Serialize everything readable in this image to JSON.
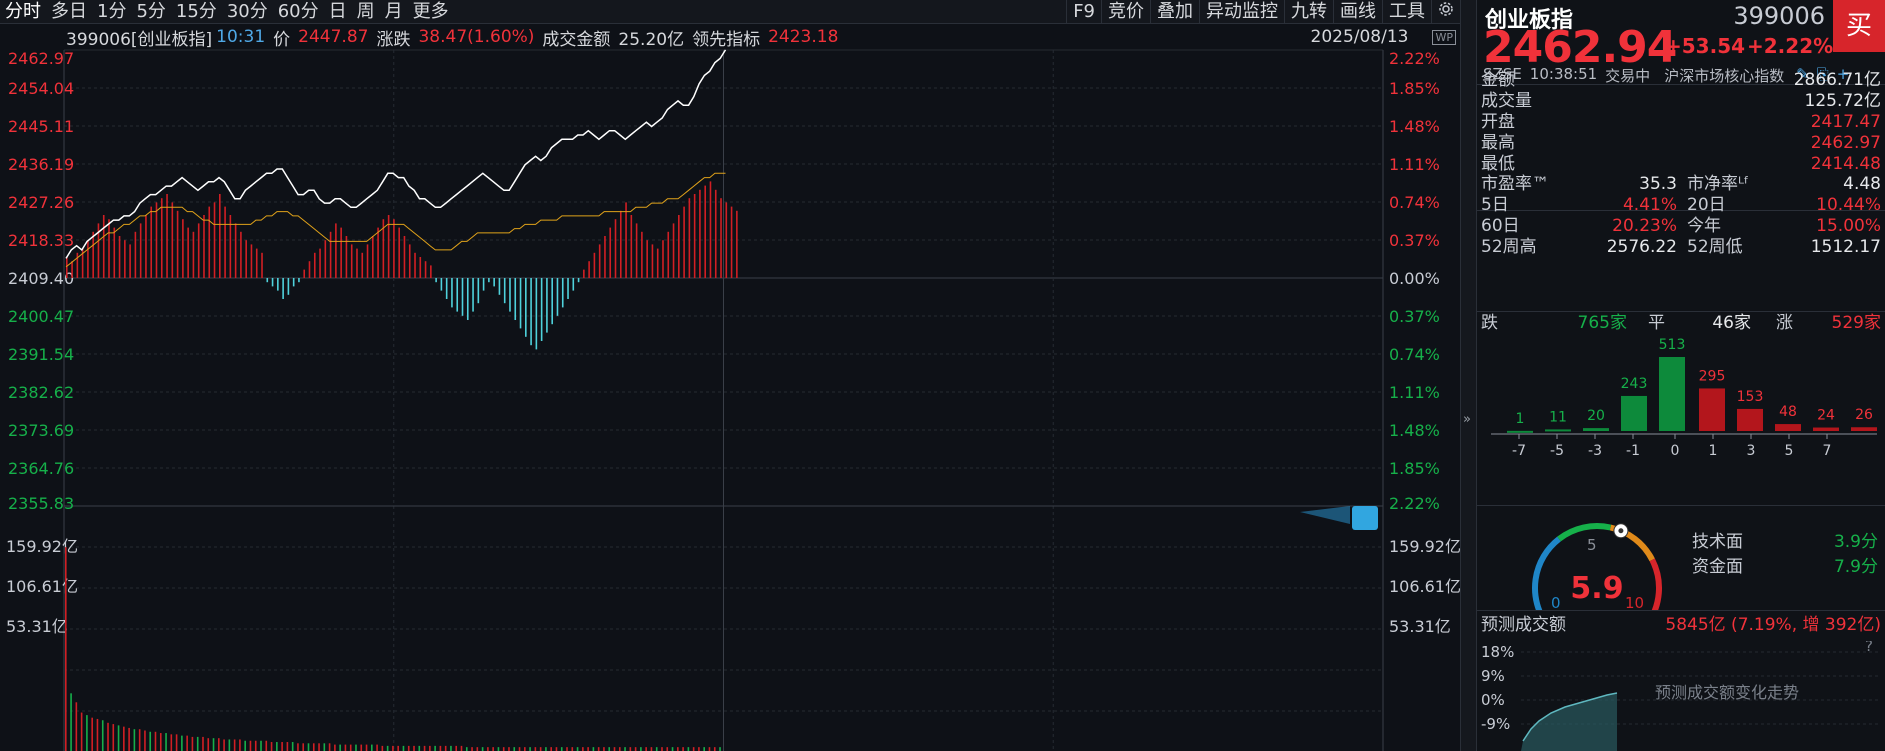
{
  "toolbar": {
    "periods": [
      "分时",
      "多日",
      "1分",
      "5分",
      "15分",
      "30分",
      "60分",
      "日",
      "周",
      "月",
      "更多"
    ],
    "tools": [
      "F9",
      "竞价",
      "叠加",
      "异动监控",
      "九转",
      "画线",
      "工具"
    ],
    "settings_icon": "gear-icon",
    "float_icon": "window-icon"
  },
  "info": {
    "code_name": "399006[创业板指]",
    "time": "10:31",
    "price_label": "价",
    "price": "2447.87",
    "change_label": "涨跌",
    "change": "38.47(1.60%)",
    "amount_label": "成交金额",
    "amount": "25.20亿",
    "lead_label": "领先指标",
    "lead": "2423.18",
    "date": "2025/08/13"
  },
  "axes": {
    "left_prices_up": [
      "2462.97",
      "2454.04",
      "2445.11",
      "2436.19",
      "2427.26",
      "2418.33"
    ],
    "base_price": "2409.40",
    "left_prices_down": [
      "2400.47",
      "2391.54",
      "2382.62",
      "2373.69",
      "2364.76",
      "2355.83"
    ],
    "right_pcts_up": [
      "2.22%",
      "1.85%",
      "1.48%",
      "1.11%",
      "0.74%",
      "0.37%"
    ],
    "base_pct": "0.00%",
    "right_pcts_down": [
      "0.37%",
      "0.74%",
      "1.11%",
      "1.48%",
      "1.85%",
      "2.22%"
    ],
    "volume_labels": [
      "159.92亿",
      "106.61亿",
      "53.31亿"
    ]
  },
  "chart_data": {
    "type": "line",
    "base": 2409.4,
    "ylim": [
      2355.83,
      2462.97
    ],
    "session_minutes": 240,
    "price_series": [
      2414,
      2416,
      2417,
      2416,
      2418,
      2419,
      2420,
      2421,
      2422,
      2423,
      2423,
      2424,
      2424,
      2425,
      2427,
      2428,
      2429,
      2429,
      2430,
      2431,
      2431,
      2432,
      2433,
      2432,
      2431,
      2430,
      2431,
      2432,
      2432,
      2433,
      2432,
      2430,
      2428,
      2428,
      2430,
      2431,
      2432,
      2433,
      2434,
      2434,
      2435,
      2435,
      2433,
      2431,
      2429,
      2429,
      2430,
      2430,
      2428,
      2427,
      2427,
      2428,
      2428,
      2427,
      2426,
      2426,
      2427,
      2428,
      2429,
      2430,
      2432,
      2434,
      2434,
      2433,
      2433,
      2431,
      2430,
      2428,
      2428,
      2427,
      2426,
      2426,
      2427,
      2428,
      2429,
      2430,
      2431,
      2432,
      2433,
      2434,
      2433,
      2432,
      2431,
      2430,
      2430,
      2432,
      2434,
      2436,
      2437,
      2438,
      2437,
      2438,
      2440,
      2441,
      2442,
      2442,
      2442,
      2443,
      2443,
      2444,
      2443,
      2442,
      2443,
      2444,
      2444,
      2443,
      2442,
      2443,
      2444,
      2445,
      2446,
      2445,
      2446,
      2447,
      2449,
      2450,
      2451,
      2450,
      2450,
      2452,
      2455,
      2457,
      2458,
      2460,
      2461,
      2463
    ],
    "avg_series": [
      2412,
      2413,
      2414,
      2415,
      2416,
      2417,
      2418,
      2419,
      2420,
      2420,
      2421,
      2422,
      2422,
      2423,
      2424,
      2424,
      2425,
      2425,
      2426,
      2426,
      2426,
      2426,
      2426,
      2425,
      2425,
      2424,
      2423,
      2423,
      2422,
      2422,
      2422,
      2422,
      2422,
      2422,
      2422,
      2422,
      2423,
      2423,
      2424,
      2424,
      2425,
      2425,
      2425,
      2424,
      2424,
      2423,
      2422,
      2421,
      2420,
      2419,
      2418,
      2418,
      2418,
      2418,
      2418,
      2418,
      2418,
      2418,
      2419,
      2420,
      2421,
      2422,
      2422,
      2422,
      2422,
      2421,
      2420,
      2419,
      2418,
      2417,
      2416,
      2416,
      2416,
      2416,
      2417,
      2418,
      2418,
      2419,
      2420,
      2420,
      2420,
      2420,
      2420,
      2420,
      2420,
      2421,
      2421,
      2422,
      2422,
      2422,
      2423,
      2423,
      2423,
      2423,
      2424,
      2424,
      2424,
      2424,
      2424,
      2424,
      2424,
      2424,
      2425,
      2425,
      2425,
      2425,
      2425,
      2425,
      2426,
      2426,
      2426,
      2427,
      2427,
      2427,
      2428,
      2428,
      2428,
      2429,
      2430,
      2431,
      2432,
      2433,
      2433,
      2434,
      2434,
      2434
    ],
    "lead_bars": [
      5,
      4,
      6,
      7,
      9,
      11,
      13,
      15,
      14,
      12,
      10,
      9,
      8,
      11,
      13,
      15,
      17,
      18,
      19,
      20,
      18,
      16,
      14,
      12,
      11,
      13,
      15,
      17,
      18,
      20,
      17,
      15,
      13,
      11,
      9,
      8,
      7,
      6,
      -1,
      -2,
      -3,
      -5,
      -4,
      -2,
      -1,
      2,
      4,
      6,
      7,
      9,
      11,
      13,
      12,
      10,
      8,
      7,
      6,
      8,
      10,
      12,
      14,
      15,
      14,
      12,
      10,
      8,
      6,
      5,
      4,
      3,
      -1,
      -3,
      -5,
      -7,
      -8,
      -9,
      -10,
      -8,
      -6,
      -3,
      -1,
      -2,
      -4,
      -6,
      -8,
      -10,
      -12,
      -14,
      -16,
      -17,
      -15,
      -13,
      -11,
      -9,
      -7,
      -5,
      -3,
      -1,
      2,
      4,
      6,
      8,
      10,
      12,
      14,
      16,
      18,
      15,
      13,
      11,
      9,
      8,
      7,
      9,
      11,
      13,
      15,
      17,
      19,
      20,
      21,
      22,
      23,
      21,
      19,
      18,
      17,
      16
    ],
    "volume_bars": [
      159,
      45,
      38,
      30,
      28,
      26,
      25,
      24,
      22,
      21,
      20,
      19,
      18,
      17,
      17,
      16,
      15,
      15,
      14,
      14,
      13,
      13,
      12,
      12,
      11,
      11,
      11,
      10,
      10,
      10,
      9,
      9,
      9,
      9,
      8,
      8,
      8,
      8,
      8,
      7,
      7,
      7,
      7,
      7,
      6,
      6,
      6,
      6,
      6,
      6,
      6,
      5,
      5,
      5,
      5,
      5,
      5,
      5,
      5,
      5,
      4,
      4,
      4,
      4,
      4,
      4,
      4,
      4,
      4,
      4,
      4,
      4,
      4,
      4,
      4,
      4,
      3,
      3,
      3,
      3,
      3,
      3,
      3,
      3,
      3,
      3,
      3,
      3,
      3,
      3,
      3,
      3,
      3,
      3,
      3,
      3,
      3,
      3,
      3,
      3,
      3,
      3,
      3,
      3,
      3,
      3,
      3,
      3,
      3,
      3,
      3,
      3,
      3,
      3,
      3,
      3,
      3,
      3,
      3,
      3,
      3,
      3,
      3,
      3,
      3
    ],
    "vol_max": 159.92
  },
  "quote": {
    "name": "创业板指",
    "code": "399006",
    "buy_label": "买",
    "price": "2462.94",
    "change": "+53.54",
    "pct": "+2.22%",
    "market": "SZSE",
    "time": "10:38:51",
    "state": "交易中",
    "desc": "沪深市场核心指数",
    "rows": [
      {
        "k": "金额",
        "v": "2866.71亿",
        "c": "white"
      },
      {
        "k": "成交量",
        "v": "125.72亿",
        "c": "white"
      },
      {
        "k": "开盘",
        "v": "2417.47",
        "c": "red"
      },
      {
        "k": "最高",
        "v": "2462.97",
        "c": "red"
      },
      {
        "k": "最低",
        "v": "2414.48",
        "c": "red"
      }
    ],
    "stats": [
      {
        "k1": "市盈率™",
        "v1": "35.3",
        "c1": "white",
        "k2": "市净率ᴸᶠ",
        "v2": "4.48",
        "c2": "white"
      },
      {
        "k1": "5日",
        "v1": "4.41%",
        "c1": "red",
        "k2": "20日",
        "v2": "10.44%",
        "c2": "red"
      },
      {
        "k1": "60日",
        "v1": "20.23%",
        "c1": "red",
        "k2": "今年",
        "v2": "15.00%",
        "c2": "red"
      },
      {
        "k1": "52周高",
        "v1": "2576.22",
        "c1": "white",
        "k2": "52周低",
        "v2": "1512.17",
        "c2": "white"
      }
    ],
    "breadth": {
      "down_label": "跌",
      "down": "765家",
      "flat_label": "平",
      "flat": "46家",
      "up_label": "涨",
      "up": "529家"
    }
  },
  "distribution": {
    "counts": [
      1,
      11,
      20,
      243,
      513,
      295,
      153,
      48,
      24,
      26
    ],
    "colors": [
      "green",
      "green",
      "green",
      "green",
      "green",
      "red",
      "red",
      "red",
      "red",
      "red"
    ],
    "axis": [
      "-7",
      "-5",
      "-3",
      "-1",
      "0",
      "1",
      "3",
      "5",
      "7"
    ]
  },
  "score": {
    "value": "5.9",
    "scale_min": "0",
    "scale_mid": "5",
    "scale_max": "10",
    "tech_label": "技术面",
    "tech": "3.9分",
    "fund_label": "资金面",
    "fund": "7.9分"
  },
  "forecast": {
    "label": "预测成交额",
    "value": "5845亿 (7.19%, 增 392亿)",
    "ticks": [
      "18%",
      "9%",
      "0%",
      "-9%"
    ],
    "note": "预测成交额变化走势",
    "help": "?"
  },
  "colors": {
    "up": "#f0323a",
    "down": "#16b04a",
    "bar_up": "#d11f24",
    "bar_down": "#4fd2dc",
    "price_line": "#ffffff",
    "avg_line": "#e0a21a",
    "bg": "#0e1117"
  }
}
